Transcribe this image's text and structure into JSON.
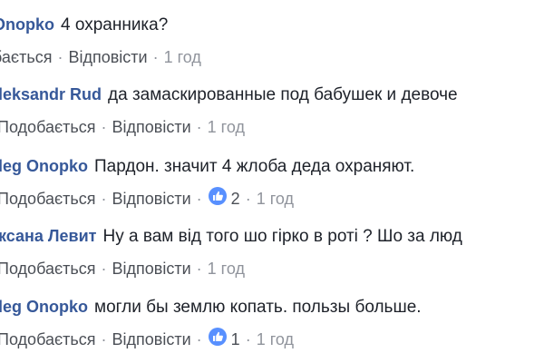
{
  "comments": [
    {
      "author": "Onopko",
      "text": "4 охранника?",
      "like_label": "бається",
      "reply_label": "Відповісти",
      "reactions": "",
      "time": "1 год"
    },
    {
      "author": "leksandr Rud",
      "text": "да замаскированные под бабушек и девоче",
      "like_label": "Подобається",
      "reply_label": "Відповісти",
      "reactions": "",
      "time": "1 год"
    },
    {
      "author": "leg Onopko",
      "text": "Пардон. значит 4 жлоба деда охраняют.",
      "like_label": "Подобається",
      "reply_label": "Відповісти",
      "reactions": "2",
      "time": "1 год"
    },
    {
      "author": "ксана Левит",
      "text": "Ну а вам від того шо гірко в роті ? Шо за люд",
      "like_label": "Подобається",
      "reply_label": "Відповісти",
      "reactions": "",
      "time": "1 год"
    },
    {
      "author": "leg Onopko",
      "text": "могли бы землю копать. пользы больше.",
      "like_label": "Подобається",
      "reply_label": "Відповісти",
      "reactions": "1",
      "time": "1 год"
    }
  ],
  "separator": "·",
  "colors": {
    "author": "#365899",
    "like_badge": "#5890ff",
    "meta": "#90949c"
  },
  "icons": {
    "like": "thumbs-up-icon"
  }
}
